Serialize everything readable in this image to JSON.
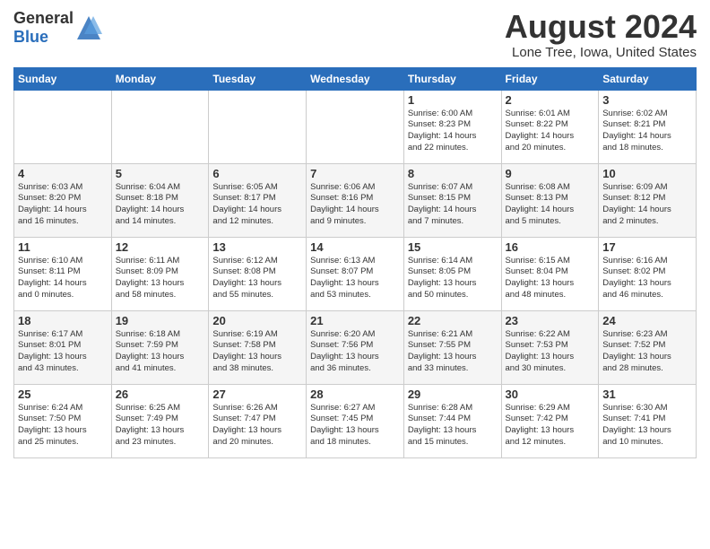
{
  "logo": {
    "general": "General",
    "blue": "Blue"
  },
  "title": "August 2024",
  "location": "Lone Tree, Iowa, United States",
  "days_of_week": [
    "Sunday",
    "Monday",
    "Tuesday",
    "Wednesday",
    "Thursday",
    "Friday",
    "Saturday"
  ],
  "weeks": [
    [
      {
        "day": "",
        "info": ""
      },
      {
        "day": "",
        "info": ""
      },
      {
        "day": "",
        "info": ""
      },
      {
        "day": "",
        "info": ""
      },
      {
        "day": "1",
        "info": "Sunrise: 6:00 AM\nSunset: 8:23 PM\nDaylight: 14 hours\nand 22 minutes."
      },
      {
        "day": "2",
        "info": "Sunrise: 6:01 AM\nSunset: 8:22 PM\nDaylight: 14 hours\nand 20 minutes."
      },
      {
        "day": "3",
        "info": "Sunrise: 6:02 AM\nSunset: 8:21 PM\nDaylight: 14 hours\nand 18 minutes."
      }
    ],
    [
      {
        "day": "4",
        "info": "Sunrise: 6:03 AM\nSunset: 8:20 PM\nDaylight: 14 hours\nand 16 minutes."
      },
      {
        "day": "5",
        "info": "Sunrise: 6:04 AM\nSunset: 8:18 PM\nDaylight: 14 hours\nand 14 minutes."
      },
      {
        "day": "6",
        "info": "Sunrise: 6:05 AM\nSunset: 8:17 PM\nDaylight: 14 hours\nand 12 minutes."
      },
      {
        "day": "7",
        "info": "Sunrise: 6:06 AM\nSunset: 8:16 PM\nDaylight: 14 hours\nand 9 minutes."
      },
      {
        "day": "8",
        "info": "Sunrise: 6:07 AM\nSunset: 8:15 PM\nDaylight: 14 hours\nand 7 minutes."
      },
      {
        "day": "9",
        "info": "Sunrise: 6:08 AM\nSunset: 8:13 PM\nDaylight: 14 hours\nand 5 minutes."
      },
      {
        "day": "10",
        "info": "Sunrise: 6:09 AM\nSunset: 8:12 PM\nDaylight: 14 hours\nand 2 minutes."
      }
    ],
    [
      {
        "day": "11",
        "info": "Sunrise: 6:10 AM\nSunset: 8:11 PM\nDaylight: 14 hours\nand 0 minutes."
      },
      {
        "day": "12",
        "info": "Sunrise: 6:11 AM\nSunset: 8:09 PM\nDaylight: 13 hours\nand 58 minutes."
      },
      {
        "day": "13",
        "info": "Sunrise: 6:12 AM\nSunset: 8:08 PM\nDaylight: 13 hours\nand 55 minutes."
      },
      {
        "day": "14",
        "info": "Sunrise: 6:13 AM\nSunset: 8:07 PM\nDaylight: 13 hours\nand 53 minutes."
      },
      {
        "day": "15",
        "info": "Sunrise: 6:14 AM\nSunset: 8:05 PM\nDaylight: 13 hours\nand 50 minutes."
      },
      {
        "day": "16",
        "info": "Sunrise: 6:15 AM\nSunset: 8:04 PM\nDaylight: 13 hours\nand 48 minutes."
      },
      {
        "day": "17",
        "info": "Sunrise: 6:16 AM\nSunset: 8:02 PM\nDaylight: 13 hours\nand 46 minutes."
      }
    ],
    [
      {
        "day": "18",
        "info": "Sunrise: 6:17 AM\nSunset: 8:01 PM\nDaylight: 13 hours\nand 43 minutes."
      },
      {
        "day": "19",
        "info": "Sunrise: 6:18 AM\nSunset: 7:59 PM\nDaylight: 13 hours\nand 41 minutes."
      },
      {
        "day": "20",
        "info": "Sunrise: 6:19 AM\nSunset: 7:58 PM\nDaylight: 13 hours\nand 38 minutes."
      },
      {
        "day": "21",
        "info": "Sunrise: 6:20 AM\nSunset: 7:56 PM\nDaylight: 13 hours\nand 36 minutes."
      },
      {
        "day": "22",
        "info": "Sunrise: 6:21 AM\nSunset: 7:55 PM\nDaylight: 13 hours\nand 33 minutes."
      },
      {
        "day": "23",
        "info": "Sunrise: 6:22 AM\nSunset: 7:53 PM\nDaylight: 13 hours\nand 30 minutes."
      },
      {
        "day": "24",
        "info": "Sunrise: 6:23 AM\nSunset: 7:52 PM\nDaylight: 13 hours\nand 28 minutes."
      }
    ],
    [
      {
        "day": "25",
        "info": "Sunrise: 6:24 AM\nSunset: 7:50 PM\nDaylight: 13 hours\nand 25 minutes."
      },
      {
        "day": "26",
        "info": "Sunrise: 6:25 AM\nSunset: 7:49 PM\nDaylight: 13 hours\nand 23 minutes."
      },
      {
        "day": "27",
        "info": "Sunrise: 6:26 AM\nSunset: 7:47 PM\nDaylight: 13 hours\nand 20 minutes."
      },
      {
        "day": "28",
        "info": "Sunrise: 6:27 AM\nSunset: 7:45 PM\nDaylight: 13 hours\nand 18 minutes."
      },
      {
        "day": "29",
        "info": "Sunrise: 6:28 AM\nSunset: 7:44 PM\nDaylight: 13 hours\nand 15 minutes."
      },
      {
        "day": "30",
        "info": "Sunrise: 6:29 AM\nSunset: 7:42 PM\nDaylight: 13 hours\nand 12 minutes."
      },
      {
        "day": "31",
        "info": "Sunrise: 6:30 AM\nSunset: 7:41 PM\nDaylight: 13 hours\nand 10 minutes."
      }
    ]
  ]
}
